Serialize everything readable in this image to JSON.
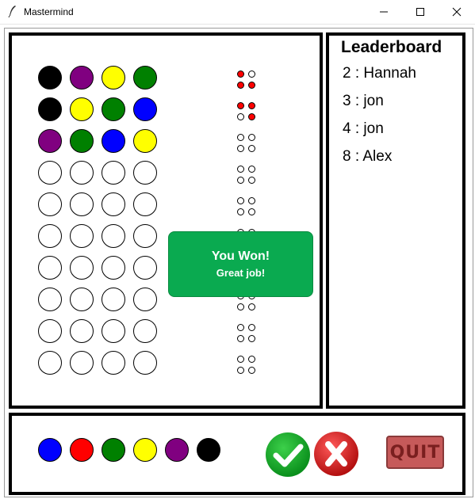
{
  "window": {
    "title": "Mastermind",
    "icon": "feather-icon",
    "controls": [
      "minimize-icon",
      "maximize-icon",
      "close-icon"
    ]
  },
  "board": {
    "guess_rows": [
      [
        "black",
        "purple",
        "yellow",
        "green"
      ],
      [
        "black",
        "yellow",
        "green",
        "blue"
      ],
      [
        "purple",
        "green",
        "blue",
        "yellow"
      ],
      [
        "empty",
        "empty",
        "empty",
        "empty"
      ],
      [
        "empty",
        "empty",
        "empty",
        "empty"
      ],
      [
        "empty",
        "empty",
        "empty",
        "empty"
      ],
      [
        "empty",
        "empty",
        "empty",
        "empty"
      ],
      [
        "empty",
        "empty",
        "empty",
        "empty"
      ],
      [
        "empty",
        "empty",
        "empty",
        "empty"
      ],
      [
        "empty",
        "empty",
        "empty",
        "empty"
      ]
    ],
    "feedback_rows": [
      [
        "red",
        "empty",
        "red",
        "red"
      ],
      [
        "red",
        "red",
        "empty",
        "red"
      ],
      [
        "empty",
        "empty",
        "empty",
        "empty"
      ],
      [
        "empty",
        "empty",
        "empty",
        "empty"
      ],
      [
        "empty",
        "empty",
        "empty",
        "empty"
      ],
      [
        "empty",
        "empty",
        "empty",
        "empty"
      ],
      [
        "empty",
        "empty",
        "empty",
        "empty"
      ],
      [
        "empty",
        "empty",
        "empty",
        "empty"
      ],
      [
        "empty",
        "empty",
        "empty",
        "empty"
      ],
      [
        "empty",
        "empty",
        "empty",
        "empty"
      ]
    ]
  },
  "colors": {
    "black": "#000000",
    "purple": "#800080",
    "yellow": "#ffff00",
    "green": "#008000",
    "blue": "#0000ff",
    "red": "#ff0000",
    "empty": "#ffffff"
  },
  "toast": {
    "title": "You Won!",
    "message": "Great job!",
    "background": "#0aaa50"
  },
  "leaderboard": {
    "title": "Leaderboard",
    "entries": [
      "2 : Hannah",
      "3 : jon",
      "4 : jon",
      "8 : Alex"
    ]
  },
  "palette": [
    "blue",
    "red",
    "green",
    "yellow",
    "purple",
    "black"
  ],
  "controls": {
    "confirm_icon": "check-icon",
    "clear_icon": "x-icon",
    "quit_label": "QUIT"
  }
}
